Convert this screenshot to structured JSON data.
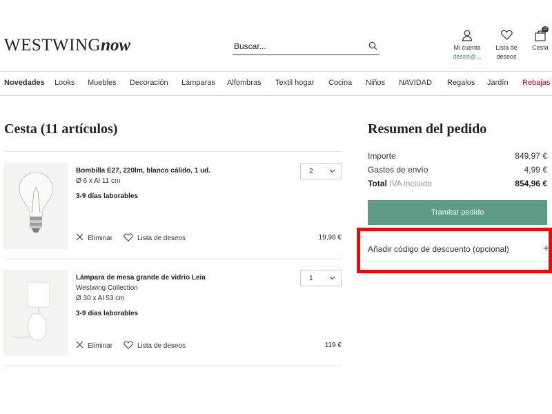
{
  "header": {
    "logo_main": "WESTWING",
    "logo_accent": "now",
    "search_placeholder": "Buscar...",
    "account_label": "Mi cuenta",
    "account_user": "desire@...",
    "wishlist_label_1": "Lista de",
    "wishlist_label_2": "deseos",
    "cart_label": "Cesta",
    "cart_count": "11"
  },
  "nav": {
    "items": [
      "Novedades",
      "Looks",
      "Muebles",
      "Decoración",
      "Lámparas",
      "Alfombras",
      "Textil hogar",
      "Cocina",
      "Niños",
      "NAVIDAD",
      "Regalos",
      "Jardín",
      "Rebajas"
    ]
  },
  "cart": {
    "title": "Cesta (11 artículos)",
    "remove_label": "Eliminar",
    "wishlist_label": "Lista de deseos",
    "items": [
      {
        "name": "Bombilla E27, 220lm, blanco cálido, 1 ud.",
        "dimensions": "Ø 6 x Al 11 cm",
        "delivery": "3-9 días laborables",
        "quantity": "2",
        "price": "19,98 €"
      },
      {
        "name": "Lámpara de mesa grande de vidrio Leia",
        "brand": "Westwing Collection",
        "dimensions": "Ø 30 x Al 53 cm",
        "delivery": "3-9 días laborables",
        "quantity": "1",
        "price": "119 €"
      }
    ]
  },
  "summary": {
    "title": "Resumen del pedido",
    "subtotal_label": "Importe",
    "subtotal_value": "849,97 €",
    "shipping_label": "Gastos de envío",
    "shipping_value": "4,99 €",
    "total_label": "Total",
    "total_note": "IVA incluido",
    "total_value": "854,96 €",
    "checkout_label": "Tramitar pedido",
    "discount_label": "Añadir código de descuento (opcional)",
    "discount_toggle": "+"
  },
  "icons": {
    "search": "search-icon",
    "account": "user-icon",
    "wishlist": "heart-icon",
    "cart": "bag-icon",
    "remove": "close-icon",
    "dropdown": "chevron-down-icon"
  },
  "colors": {
    "accent_green": "#5e9b86",
    "sale_red": "#a3102c",
    "highlight": "#ff0000"
  }
}
